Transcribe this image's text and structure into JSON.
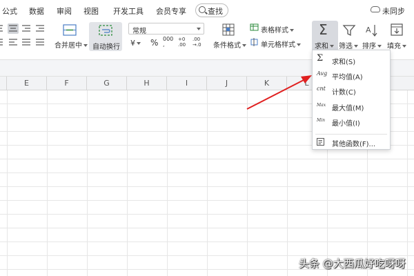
{
  "menubar": {
    "items": [
      "公式",
      "数据",
      "审阅",
      "视图",
      "开发工具",
      "会员专享"
    ],
    "search_label": "查找",
    "sync_label": "未同步"
  },
  "ribbon": {
    "merge_label": "合并居中",
    "wrap_label": "自动换行",
    "number_format": "常规",
    "currency_symbol": "¥",
    "percent_symbol": "%",
    "thousands_symbol": "000",
    "inc_decimal_top": "+0",
    "inc_decimal_bottom": ".00",
    "dec_decimal_top": ".00",
    "dec_decimal_bottom": "→.0",
    "conditional_format_label": "条件格式",
    "table_style_label": "表格样式",
    "cell_style_label": "单元格样式",
    "sum_label": "求和",
    "filter_label": "筛选",
    "sort_label": "排序",
    "fill_label": "填充"
  },
  "sheet": {
    "columns": [
      "E",
      "F",
      "G",
      "H",
      "I",
      "J",
      "K",
      "L"
    ]
  },
  "sum_menu": {
    "items": [
      {
        "icon_text": "Σ",
        "label": "求和(S)"
      },
      {
        "icon_text": "Avg",
        "label": "平均值(A)"
      },
      {
        "icon_text": "cnt",
        "label": "计数(C)"
      },
      {
        "icon_text": "Max",
        "label": "最大值(M)"
      },
      {
        "icon_text": "Min",
        "label": "最小值(I)"
      }
    ],
    "more_label": "其他函数(F)..."
  },
  "watermark": "头条 @大西瓜好吃呀呀",
  "colors": {
    "arrow": "#e02020",
    "active_button": "#d8dadf",
    "grid_line": "#e6e6e6"
  }
}
